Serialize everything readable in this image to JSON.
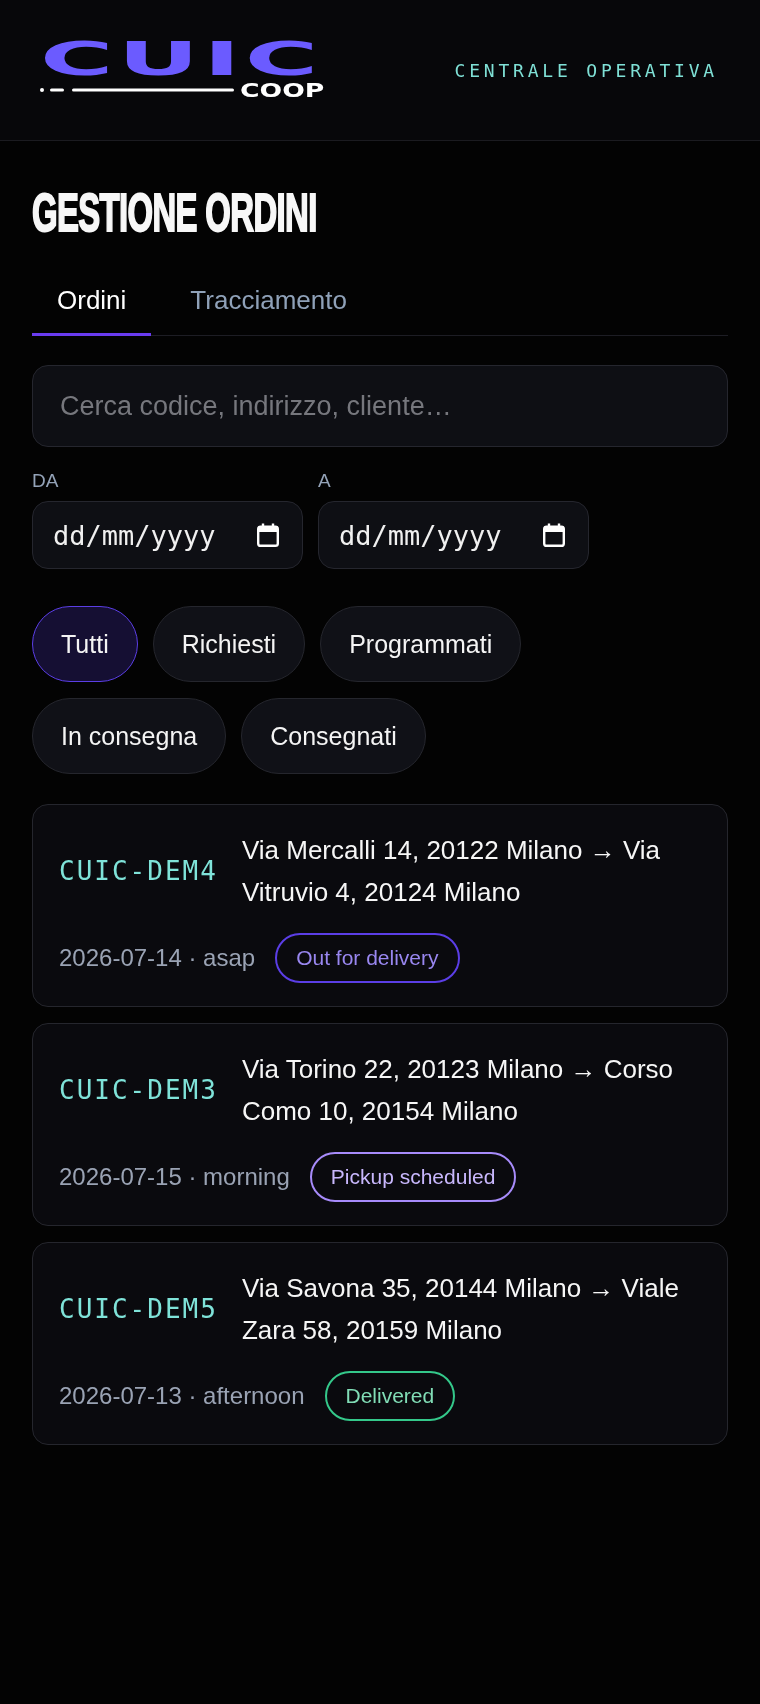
{
  "header": {
    "logo": {
      "wordmark": "CUIC",
      "subtitle": "COOP"
    },
    "tagline": "CENTRALE OPERATIVA"
  },
  "page_title": "GESTIONE ORDINI",
  "tabs": [
    {
      "label": "Ordini",
      "selected": true
    },
    {
      "label": "Tracciamento",
      "selected": false
    }
  ],
  "search": {
    "placeholder": "Cerca codice, indirizzo, cliente…"
  },
  "date_range": [
    {
      "label": "DA",
      "placeholder": "dd/mm/yyyy"
    },
    {
      "label": "A",
      "placeholder": "dd/mm/yyyy"
    }
  ],
  "filters": [
    {
      "label": "Tutti",
      "selected": true
    },
    {
      "label": "Richiesti",
      "selected": false
    },
    {
      "label": "Programmati",
      "selected": false
    },
    {
      "label": "In consegna",
      "selected": false
    },
    {
      "label": "Consegnati",
      "selected": false
    }
  ],
  "orders": [
    {
      "code": "CUIC-DEM4",
      "route": "Via Mercalli 14, 20122 Milano → Via Vitruvio 4, 20124 Milano",
      "schedule": "2026-07-14 · asap",
      "status": {
        "label": "Out for delivery",
        "color": "#5b3ee6"
      }
    },
    {
      "code": "CUIC-DEM3",
      "route": "Via Torino 22, 20123 Milano → Corso Como 10, 20154 Milano",
      "schedule": "2026-07-15 · morning",
      "status": {
        "label": "Pickup scheduled",
        "color": "#a78bfa"
      }
    },
    {
      "code": "CUIC-DEM5",
      "route": "Via Savona 35, 20144 Milano → Viale Zara 58, 20159 Milano",
      "schedule": "2026-07-13 · afternoon",
      "status": {
        "label": "Delivered",
        "color": "#34c88a"
      }
    }
  ]
}
